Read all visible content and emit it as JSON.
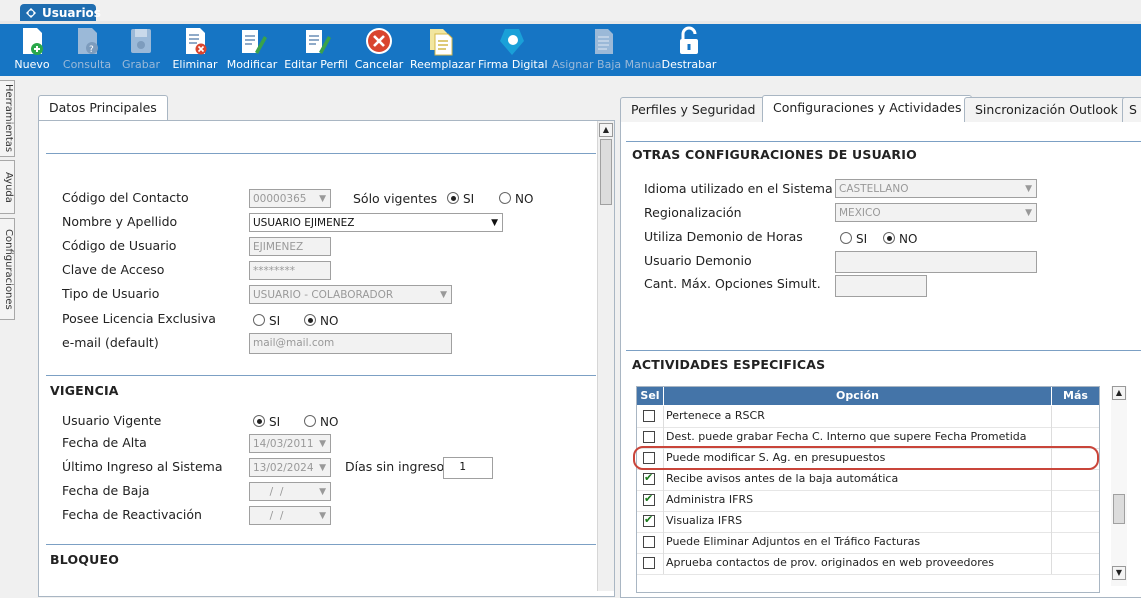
{
  "window_tab": {
    "title": "Usuarios"
  },
  "toolbar": [
    {
      "label": "Nuevo",
      "icon": "new-doc-icon",
      "enabled": true
    },
    {
      "label": "Consulta",
      "icon": "query-icon",
      "enabled": false
    },
    {
      "label": "Grabar",
      "icon": "save-icon",
      "enabled": false
    },
    {
      "label": "Eliminar",
      "icon": "delete-doc-icon",
      "enabled": true
    },
    {
      "label": "Modificar",
      "icon": "edit-icon",
      "enabled": true
    },
    {
      "label": "Editar Perfil",
      "icon": "edit-profile-icon",
      "enabled": true
    },
    {
      "label": "Cancelar",
      "icon": "cancel-icon",
      "enabled": true
    },
    {
      "label": "Reemplazar",
      "icon": "replace-icon",
      "enabled": true
    },
    {
      "label": "Firma Digital",
      "icon": "digital-signature-icon",
      "enabled": true
    },
    {
      "label": "Asignar Baja Manual",
      "icon": "manual-deregister-icon",
      "enabled": false
    },
    {
      "label": "Destrabar",
      "icon": "unlock-icon",
      "enabled": true
    }
  ],
  "side_tabs": [
    "Herramientas",
    "Ayuda",
    "Configuraciones"
  ],
  "left_panel": {
    "tab": "Datos Principales",
    "fields": {
      "codigo_contacto": {
        "label": "Código del Contacto",
        "value": "00000365"
      },
      "solo_vigentes": {
        "label": "Sólo vigentes",
        "si": "SI",
        "no": "NO"
      },
      "nombre": {
        "label": "Nombre y Apellido",
        "value": "USUARIO EJIMENEZ"
      },
      "codigo_usuario": {
        "label": "Código de Usuario",
        "value": "EJIMENEZ"
      },
      "clave": {
        "label": "Clave de Acceso",
        "value": "********"
      },
      "tipo_usuario": {
        "label": "Tipo de Usuario",
        "value": "USUARIO - COLABORADOR"
      },
      "licencia": {
        "label": "Posee Licencia Exclusiva",
        "si": "SI",
        "no": "NO"
      },
      "email": {
        "label": "e-mail (default)",
        "value": "mail@mail.com"
      }
    },
    "vigencia": {
      "title": "VIGENCIA",
      "usuario_vigente": {
        "label": "Usuario Vigente",
        "si": "SI",
        "no": "NO"
      },
      "fecha_alta": {
        "label": "Fecha de Alta",
        "value": "14/03/2011"
      },
      "ultimo_ingreso": {
        "label": "Último Ingreso al Sistema",
        "value": "13/02/2024"
      },
      "dias_sin_ingreso": {
        "label": "Días sin ingreso",
        "value": "1"
      },
      "fecha_baja": {
        "label": "Fecha de Baja",
        "value": "  /  /"
      },
      "fecha_reactivacion": {
        "label": "Fecha de Reactivación",
        "value": "  /  /"
      }
    },
    "bloqueo": {
      "title": "BLOQUEO"
    }
  },
  "right_panel": {
    "tabs": [
      "Perfiles y Seguridad",
      "Configuraciones y Actividades",
      "Sincronización Outlook",
      "S"
    ],
    "otras": {
      "title": "OTRAS CONFIGURACIONES DE USUARIO",
      "idioma": {
        "label": "Idioma utilizado en el Sistema",
        "value": "CASTELLANO"
      },
      "regionalizacion": {
        "label": "Regionalización",
        "value": "MEXICO"
      },
      "demonio_horas": {
        "label": "Utiliza Demonio de Horas",
        "si": "SI",
        "no": "NO"
      },
      "usuario_demonio": {
        "label": "Usuario Demonio",
        "value": ""
      },
      "cant_max": {
        "label": "Cant. Máx. Opciones Simult.",
        "value": ""
      }
    },
    "actividades": {
      "title": "ACTIVIDADES ESPECIFICAS",
      "columns": {
        "sel": "Sel",
        "opcion": "Opción",
        "mas": "Más"
      },
      "rows": [
        {
          "text": "Pertenece a RSCR",
          "checked": false
        },
        {
          "text": "Dest. puede grabar Fecha C. Interno que supere Fecha Prometida",
          "checked": false
        },
        {
          "text": "Puede modificar S. Ag. en presupuestos",
          "checked": false
        },
        {
          "text": "Recibe avisos antes de la baja automática",
          "checked": true
        },
        {
          "text": "Administra IFRS",
          "checked": true
        },
        {
          "text": "Visualiza IFRS",
          "checked": true
        },
        {
          "text": "Puede Eliminar Adjuntos en el Tráfico Facturas",
          "checked": false
        },
        {
          "text": "Aprueba contactos de prov. originados en web proveedores",
          "checked": false
        }
      ]
    }
  },
  "colors": {
    "toolbar": "#1675c4",
    "grid_header": "#4474a8",
    "highlight": "#c9453a"
  }
}
